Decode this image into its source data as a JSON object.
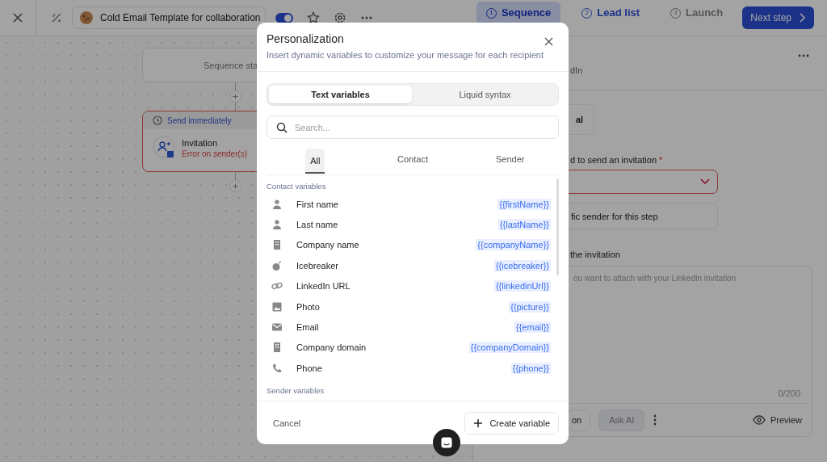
{
  "topbar": {
    "title": "Cold Email Template for collaboration",
    "toggle": {
      "on": true
    },
    "steps": [
      {
        "number": "1",
        "label": "Sequence",
        "selected": true,
        "disabled": false
      },
      {
        "number": "2",
        "label": "Lead list",
        "selected": false,
        "disabled": false
      },
      {
        "number": "3",
        "label": "Launch",
        "selected": false,
        "disabled": true
      }
    ],
    "next_button": "Next step"
  },
  "canvas": {
    "start_node": "Sequence sta",
    "step": {
      "delay": "Send immediately",
      "title": "Invitation",
      "error": "Error on sender(s)"
    }
  },
  "panel": {
    "header": "dIn",
    "option": "al",
    "sender_label": "d to send an invitation",
    "required_mark": "*",
    "sender_option": "fic sender for this step",
    "message_label": "the invitation",
    "message_placeholder": "ou want to attach with your Linkedin invitation",
    "counter": "0/200",
    "toolbar": [
      "on",
      "Ask AI"
    ],
    "preview": "Preview"
  },
  "modal": {
    "title": "Personalization",
    "subtitle": "Insert dynamic variables to customize your message for each recipient",
    "modes": [
      {
        "label": "Text variables",
        "selected": true
      },
      {
        "label": "Liquid syntax",
        "selected": false
      }
    ],
    "search": {
      "placeholder": "Search..."
    },
    "filters": [
      {
        "label": "All",
        "selected": true
      },
      {
        "label": "Contact",
        "selected": false
      },
      {
        "label": "Sender",
        "selected": false
      }
    ],
    "sections": [
      {
        "title": "Contact variables",
        "items": [
          {
            "kind": "person",
            "label": "First name",
            "variable": "{{firstName}}"
          },
          {
            "kind": "person",
            "label": "Last name",
            "variable": "{{lastName}}"
          },
          {
            "kind": "building",
            "label": "Company name",
            "variable": "{{companyName}}"
          },
          {
            "kind": "bomb",
            "label": "Icebreaker",
            "variable": "{{icebreaker}}"
          },
          {
            "kind": "link",
            "label": "LinkedIn URL",
            "variable": "{{linkedinUrl}}"
          },
          {
            "kind": "image",
            "label": "Photo",
            "variable": "{{picture}}"
          },
          {
            "kind": "mail",
            "label": "Email",
            "variable": "{{email}}"
          },
          {
            "kind": "building",
            "label": "Company domain",
            "variable": "{{companyDomain}}"
          },
          {
            "kind": "phone",
            "label": "Phone",
            "variable": "{{phone}}"
          }
        ]
      },
      {
        "title": "Sender variables"
      }
    ],
    "cancel": "Cancel",
    "create": "Create variable"
  }
}
